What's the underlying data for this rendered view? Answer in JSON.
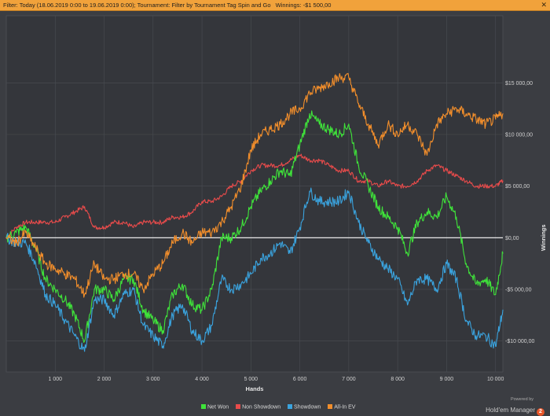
{
  "header": {
    "filter_label": "Filter: Today (18.06.2019 0:00 to 19.06.2019 0:00); Tournament: Filter by Tournament Tag  Spin and Go",
    "winnings_label": "Winnings: -$1 500,00",
    "close_icon": "close-icon"
  },
  "chart_data": {
    "type": "line",
    "xlabel": "Hands",
    "ylabel": "Winnings",
    "xlim": [
      0,
      10150
    ],
    "ylim": [
      -13000,
      21500
    ],
    "x_ticks": [
      1000,
      2000,
      3000,
      4000,
      5000,
      6000,
      7000,
      8000,
      9000,
      10000
    ],
    "x_tick_labels": [
      "1 000",
      "2 000",
      "3 000",
      "4 000",
      "5 000",
      "6 000",
      "7 000",
      "8 000",
      "9 000",
      "10 000"
    ],
    "y_ticks": [
      -10000,
      -5000,
      0,
      5000,
      10000,
      15000
    ],
    "y_tick_labels": [
      "-$10 000,00",
      "-$5 000,00",
      "$0,00",
      "$5 000,00",
      "$10 000,00",
      "$15 000,00"
    ],
    "grid": true,
    "legend_position": "bottom-center",
    "x": [
      0,
      200,
      400,
      600,
      800,
      1000,
      1200,
      1400,
      1600,
      1800,
      2000,
      2200,
      2400,
      2600,
      2800,
      3000,
      3200,
      3400,
      3600,
      3800,
      4000,
      4200,
      4400,
      4600,
      4800,
      5000,
      5200,
      5400,
      5600,
      5800,
      6000,
      6200,
      6400,
      6600,
      6800,
      7000,
      7200,
      7400,
      7600,
      7800,
      8000,
      8200,
      8400,
      8600,
      8800,
      9000,
      9200,
      9400,
      9600,
      9800,
      10000,
      10150
    ],
    "series": [
      {
        "name": "Net Won",
        "color": "#3fe33a",
        "values": [
          0,
          500,
          1000,
          -1000,
          -4000,
          -5000,
          -6000,
          -7500,
          -10000,
          -5000,
          -5000,
          -6000,
          -4000,
          -4000,
          -7000,
          -8000,
          -9000,
          -5500,
          -4500,
          -6500,
          -7000,
          -5000,
          0,
          0,
          1000,
          3000,
          4500,
          5500,
          6500,
          6000,
          9000,
          12000,
          11000,
          10500,
          10000,
          11000,
          7000,
          5000,
          3000,
          2000,
          1000,
          -1500,
          1500,
          2500,
          2000,
          4000,
          2000,
          -2500,
          -4500,
          -4000,
          -5500,
          -1500
        ]
      },
      {
        "name": "Non Showdown",
        "color": "#e84b4b",
        "values": [
          0,
          1000,
          1500,
          1500,
          1500,
          1500,
          2000,
          2500,
          3000,
          1000,
          1000,
          1500,
          1500,
          1000,
          1500,
          1500,
          1500,
          2000,
          2000,
          2500,
          3500,
          3500,
          4000,
          5000,
          5500,
          6500,
          7000,
          7000,
          7000,
          7500,
          8000,
          7500,
          7500,
          7000,
          6500,
          6500,
          5500,
          5500,
          5000,
          5500,
          5000,
          5000,
          5500,
          6500,
          7000,
          6500,
          6000,
          5500,
          5000,
          5000,
          5000,
          5500
        ]
      },
      {
        "name": "Showdown",
        "color": "#3aa3de",
        "values": [
          0,
          -500,
          -500,
          -2500,
          -5500,
          -6500,
          -8000,
          -9500,
          -11000,
          -6000,
          -6000,
          -7500,
          -5500,
          -5000,
          -8500,
          -9500,
          -10500,
          -7500,
          -6500,
          -9000,
          -10000,
          -8500,
          -4000,
          -5000,
          -4500,
          -3500,
          -2000,
          -1500,
          -500,
          -1500,
          1000,
          4500,
          3500,
          3500,
          3500,
          4500,
          1500,
          -500,
          -2000,
          -3000,
          -4000,
          -6500,
          -4000,
          -4000,
          -5000,
          -2500,
          -4000,
          -8000,
          -9500,
          -9500,
          -10500,
          -7000
        ]
      },
      {
        "name": "All-In EV",
        "color": "#f28e2b",
        "values": [
          0,
          -500,
          500,
          -1000,
          -2500,
          -3000,
          -3500,
          -4000,
          -5500,
          -2500,
          -4000,
          -4000,
          -3500,
          -3500,
          -5000,
          -3500,
          -2500,
          -500,
          500,
          -500,
          500,
          500,
          1500,
          3000,
          5000,
          8500,
          10000,
          10500,
          11000,
          12000,
          12500,
          14000,
          14500,
          15000,
          15500,
          15500,
          13000,
          11000,
          9000,
          11000,
          10000,
          11000,
          10000,
          8000,
          11000,
          12000,
          12500,
          12000,
          11500,
          11000,
          11500,
          12000
        ]
      }
    ]
  },
  "legend": [
    {
      "label": "Net Won",
      "color": "#3fe33a"
    },
    {
      "label": "Non Showdown",
      "color": "#e84b4b"
    },
    {
      "label": "Showdown",
      "color": "#3aa3de"
    },
    {
      "label": "All-In EV",
      "color": "#f28e2b"
    }
  ],
  "brand": {
    "powered": "Powered by",
    "name": "Hold'em Manager",
    "badge": "2"
  }
}
